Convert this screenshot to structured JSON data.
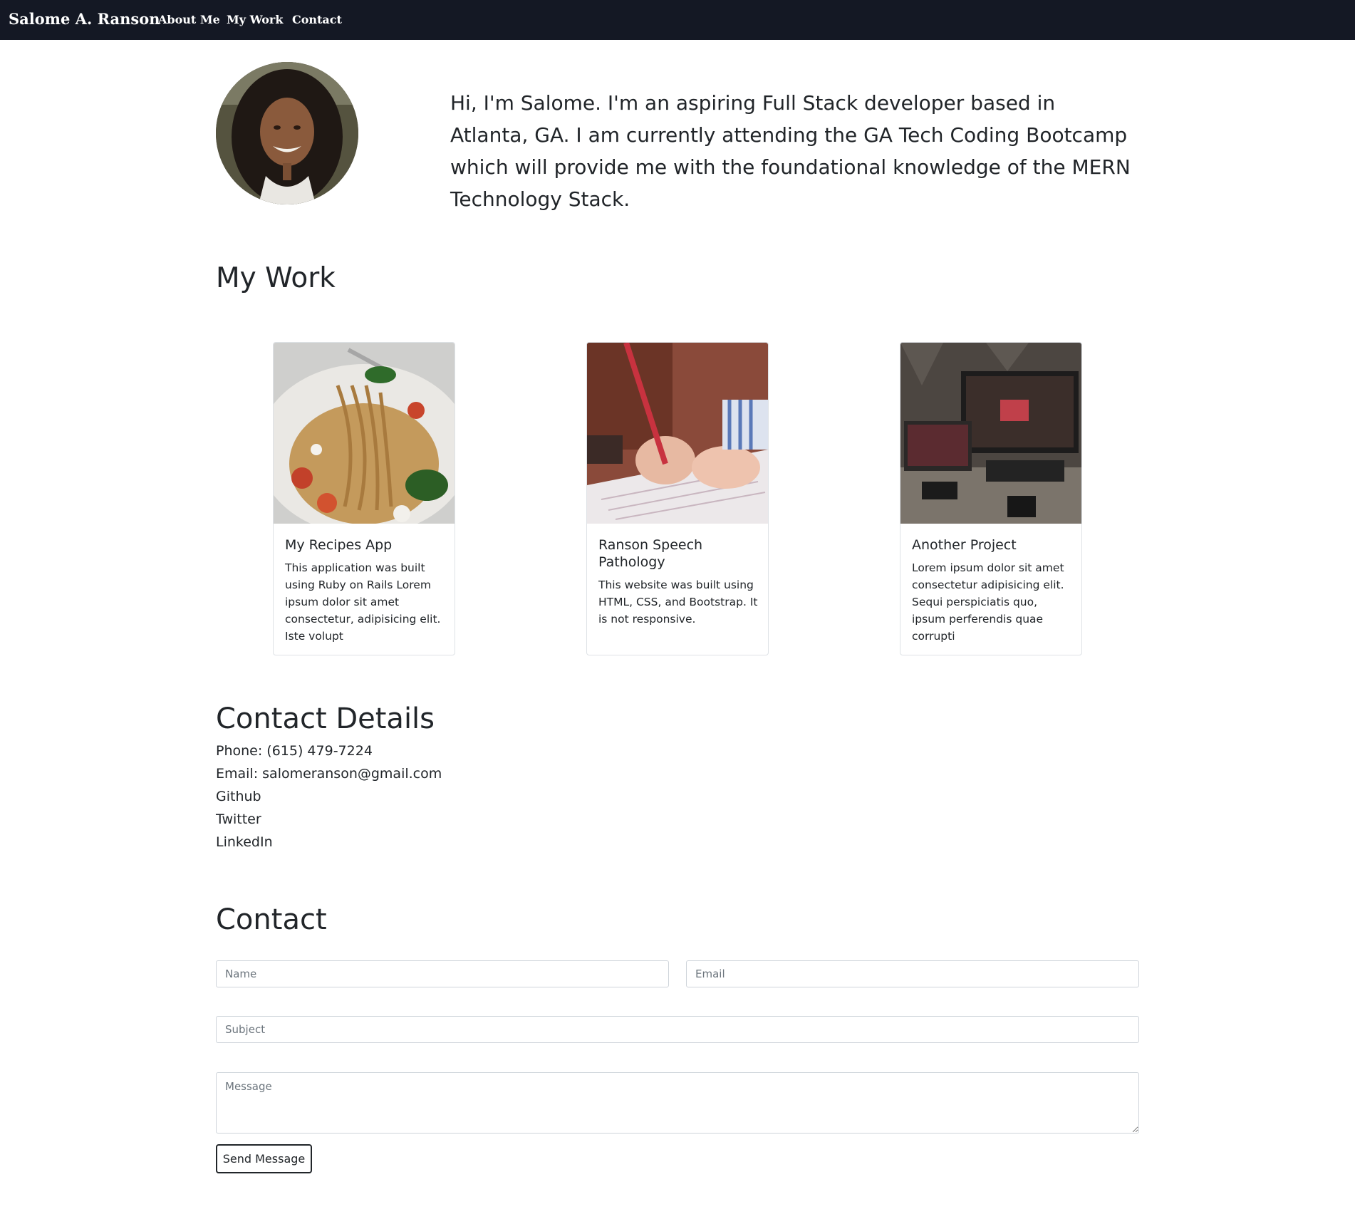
{
  "navbar": {
    "brand": "Salome A. Ranson",
    "links": [
      "About Me",
      "My Work",
      "Contact"
    ]
  },
  "about": {
    "bio": "Hi, I'm Salome. I'm an aspiring Full Stack developer based in Atlanta, GA. I am currently attending the GA Tech Coding Bootcamp which will provide me with the foundational knowledge of the MERN Technology Stack."
  },
  "work": {
    "title": "My Work",
    "cards": [
      {
        "title": "My Recipes App",
        "text": "This application was built using Ruby on Rails Lorem ipsum dolor sit amet consectetur, adipisicing elit. Iste volupt"
      },
      {
        "title": "Ranson Speech Pathology",
        "text": "This website was built using HTML, CSS, and Bootstrap. It is not responsive."
      },
      {
        "title": "Another Project",
        "text": "Lorem ipsum dolor sit amet consectetur adipisicing elit. Sequi perspiciatis quo, ipsum perferendis quae corrupti"
      }
    ]
  },
  "details": {
    "title": "Contact Details",
    "phone": "Phone: (615) 479-7224",
    "email": "Email: salomeranson@gmail.com",
    "github": "Github",
    "twitter": "Twitter",
    "linkedin": "LinkedIn"
  },
  "contact": {
    "title": "Contact",
    "name_placeholder": "Name",
    "email_placeholder": "Email",
    "subject_placeholder": "Subject",
    "message_placeholder": "Message",
    "send_label": "Send Message"
  },
  "colors": {
    "navbar_bg": "#141824",
    "text": "#212529",
    "border": "#ced4da"
  },
  "icons": [
    "profile-photo",
    "pasta-photo",
    "child-writing-photo",
    "desk-computer-photo"
  ]
}
